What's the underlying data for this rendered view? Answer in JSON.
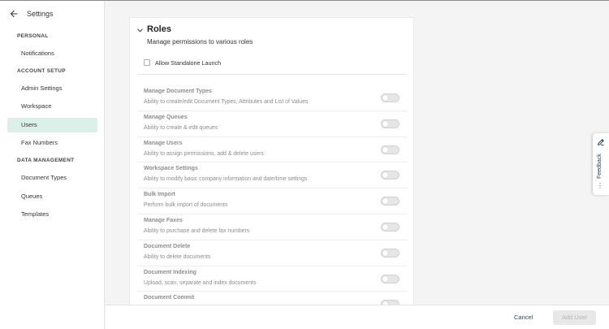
{
  "sidebar": {
    "title": "Settings",
    "sections": {
      "personal": "PERSONAL",
      "account_setup": "ACCOUNT SETUP",
      "data_management": "DATA MANAGEMENT"
    },
    "items": {
      "notifications": "Notifications",
      "admin_settings": "Admin Settings",
      "workspace": "Workspace",
      "users": "Users",
      "fax_numbers": "Fax Numbers",
      "document_types": "Document Types",
      "queues": "Queues",
      "templates": "Templates"
    },
    "active_item": "Users"
  },
  "roles": {
    "title": "Roles",
    "subtitle": "Manage permissions to various roles",
    "standalone_label": "Allow Standalone Launch",
    "standalone_checked": false,
    "permissions": [
      {
        "name": "Manage Document Types",
        "desc": "Ability to create/edit Document Types, Attributes and List of Values",
        "enabled": false
      },
      {
        "name": "Manage Queues",
        "desc": "Ability to create & edit queues",
        "enabled": false
      },
      {
        "name": "Manage Users",
        "desc": "Ability to assign permissions, add & delete users",
        "enabled": false
      },
      {
        "name": "Workspace Settings",
        "desc": "Ability to modify basic company information and date/time settings",
        "enabled": false
      },
      {
        "name": "Bulk Import",
        "desc": "Perform bulk import of documents",
        "enabled": false
      },
      {
        "name": "Manage Faxes",
        "desc": "Ability to purchase and delete fax numbers",
        "enabled": false
      },
      {
        "name": "Document Delete",
        "desc": "Ability to delete documents",
        "enabled": false
      },
      {
        "name": "Document Indexing",
        "desc": "Upload, scan, separate and index documents",
        "enabled": false
      },
      {
        "name": "Document Commit",
        "desc": "",
        "enabled": false
      }
    ]
  },
  "footer": {
    "cancel_label": "Cancel",
    "add_label": "Add User"
  },
  "feedback": {
    "label": "Feedback"
  },
  "colors": {
    "accent": "#dcefe9",
    "link": "#1f4f5f",
    "disabled_text": "#8d8d8d"
  },
  "icons": {
    "back": "arrow-left-icon",
    "collapse": "chevron-down-icon",
    "feedback": "pencil-icon",
    "more": "more-dots-icon"
  }
}
